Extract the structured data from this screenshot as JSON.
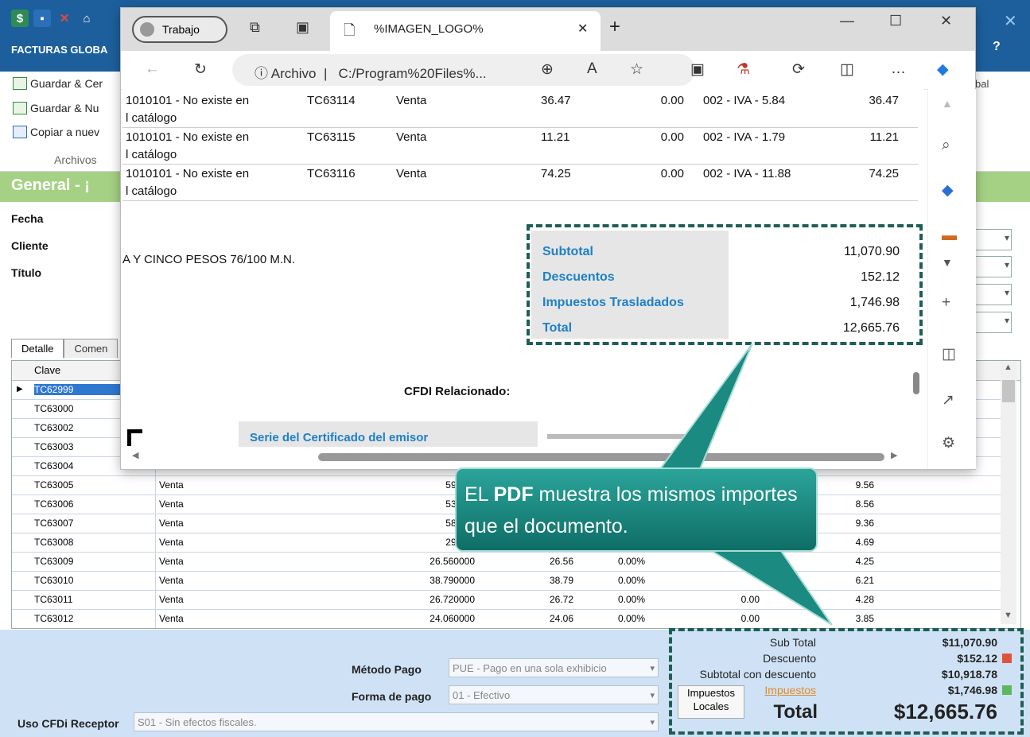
{
  "app": {
    "title": "FACTURAS GLOBA",
    "ribbon_items": [
      "Guardar & Cer",
      "Guardar & Nu",
      "Copiar a nuev"
    ],
    "ribbon_group": "Archivos",
    "ribbon_right": "bal",
    "section_title": "General - ¡",
    "labels": {
      "fecha": "Fecha",
      "cliente": "Cliente",
      "titulo": "Título"
    },
    "tabs": [
      "Detalle",
      "Comen"
    ],
    "grid_header": "Clave",
    "rows": [
      {
        "clave": "TC62999",
        "tipo": "",
        "n1": "",
        "n2": "",
        "n3": "",
        "n4": "",
        "n5": ""
      },
      {
        "clave": "TC63000",
        "tipo": "",
        "n1": "",
        "n2": "",
        "n3": "",
        "n4": "",
        "n5": ""
      },
      {
        "clave": "TC63002",
        "tipo": "",
        "n1": "",
        "n2": "",
        "n3": "",
        "n4": "",
        "n5": ""
      },
      {
        "clave": "TC63003",
        "tipo": "",
        "n1": "",
        "n2": "",
        "n3": "",
        "n4": "",
        "n5": ""
      },
      {
        "clave": "TC63004",
        "tipo": "",
        "n1": "",
        "n2": "",
        "n3": "",
        "n4": "",
        "n5": ""
      },
      {
        "clave": "TC63005",
        "tipo": "Venta",
        "n1": "59.740",
        "n2": "",
        "n3": "",
        "n4": "",
        "n5": "9.56"
      },
      {
        "clave": "TC63006",
        "tipo": "Venta",
        "n1": "53.530",
        "n2": "",
        "n3": "",
        "n4": "",
        "n5": "8.56"
      },
      {
        "clave": "TC63007",
        "tipo": "Venta",
        "n1": "58.480",
        "n2": "",
        "n3": "",
        "n4": "",
        "n5": "9.36"
      },
      {
        "clave": "TC63008",
        "tipo": "Venta",
        "n1": "29.310",
        "n2": "",
        "n3": "",
        "n4": "",
        "n5": "4.69"
      },
      {
        "clave": "TC63009",
        "tipo": "Venta",
        "n1": "26.560000",
        "n2": "26.56",
        "n3": "0.00%",
        "n4": "",
        "n5": "4.25"
      },
      {
        "clave": "TC63010",
        "tipo": "Venta",
        "n1": "38.790000",
        "n2": "38.79",
        "n3": "0.00%",
        "n4": "",
        "n5": "6.21"
      },
      {
        "clave": "TC63011",
        "tipo": "Venta",
        "n1": "26.720000",
        "n2": "26.72",
        "n3": "0.00%",
        "n4": "0.00",
        "n5": "4.28"
      },
      {
        "clave": "TC63012",
        "tipo": "Venta",
        "n1": "24.060000",
        "n2": "24.06",
        "n3": "0.00%",
        "n4": "0.00",
        "n5": "3.85"
      }
    ],
    "bottom": {
      "metodo_label": "Método Pago",
      "metodo_value": "PUE - Pago en una sola exhibicio",
      "forma_label": "Forma de pago",
      "forma_value": "01 - Efectivo",
      "uso_label": "Uso CFDi Receptor",
      "uso_value": "S01 - Sin efectos fiscales.",
      "imp_locales": "Impuestos Locales",
      "totals": {
        "subtotal_label": "Sub Total",
        "subtotal": "$11,070.90",
        "descuento_label": "Descuento",
        "descuento": "$152.12",
        "subdesc_label": "Subtotal con descuento",
        "subdesc": "$10,918.78",
        "impuestos_label": "Impuestos",
        "impuestos": "$1,746.98",
        "total_label": "Total",
        "total": "$12,665.76"
      }
    }
  },
  "browser": {
    "profile": "Trabajo",
    "tab_title": "%IMAGEN_LOGO%",
    "address_prefix": "Archivo",
    "address": "C:/Program%20Files%...",
    "pdf_rows": [
      {
        "desc1": "1010101 - No existe en",
        "desc2": "l catálogo",
        "code": "TC63114",
        "tipo": "Venta",
        "amt": "36.47",
        "desc": "0.00",
        "tax": "002 - IVA - 5.84",
        "total": "36.47"
      },
      {
        "desc1": "1010101 - No existe en",
        "desc2": "l catálogo",
        "code": "TC63115",
        "tipo": "Venta",
        "amt": "11.21",
        "desc": "0.00",
        "tax": "002 - IVA - 1.79",
        "total": "11.21"
      },
      {
        "desc1": "1010101 - No existe en",
        "desc2": "l catálogo",
        "code": "TC63116",
        "tipo": "Venta",
        "amt": "74.25",
        "desc": "0.00",
        "tax": "002 - IVA - 11.88",
        "total": "74.25"
      }
    ],
    "amount_words": "A Y CINCO PESOS 76/100 M.N.",
    "summary": [
      {
        "label": "Subtotal",
        "value": "11,070.90"
      },
      {
        "label": "Descuentos",
        "value": "152.12"
      },
      {
        "label": "Impuestos Trasladados",
        "value": "1,746.98"
      },
      {
        "label": "Total",
        "value": "12,665.76"
      }
    ],
    "cfdi_relacionado": "CFDI Relacionado:",
    "serie_label": "Serie del Certificado del emisor"
  },
  "callout": {
    "pre": "EL ",
    "bold": "PDF",
    "post": " muestra los mismos importes que el documento."
  },
  "colors": {
    "accent_teal": "#1e5f55",
    "app_blue": "#1d5f9c",
    "pdf_label_blue": "#1f80c6"
  }
}
